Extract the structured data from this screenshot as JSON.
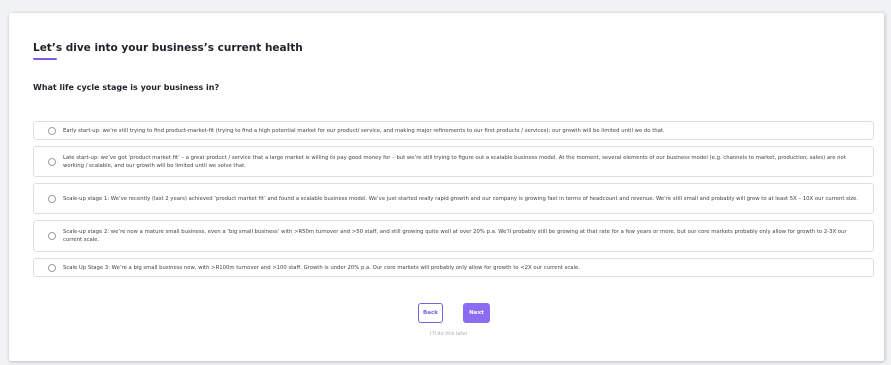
{
  "page": {
    "heading": "Let’s dive into your business’s current health",
    "question": "What life cycle stage is your business in?"
  },
  "options": [
    {
      "label": "Early start-up: we’re still trying to find product-market-fit (trying to find a high potential market for our product/ service, and making major refinements to our first products / services); our growth will be limited until we do that."
    },
    {
      "label": "Late start-up: we’ve got ‘product market fit’ – a great product / service that a large market is willing to pay good money for – but we’re still trying to figure out a scalable business model. At the moment, several elements of our business model (e.g. channels to market, production, sales) are not working / scalable, and our growth will be limited until we solve that."
    },
    {
      "label": "Scale-up stage 1: We’ve recently (last 2 years) achieved ‘product market fit’ and found a scalable business model. We’ve just started really rapid growth and our company is growing fast in terms of headcount and revenue. We’re still small and probably will grow to at least 5X – 10X our current size."
    },
    {
      "label": "Scale-up stage 2: we’re now a mature small business, even a ‘big small business’ with >R50m turnover and >50 staff, and still growing quite well at over 20% p.a. We’ll probably still be growing at that rate for a few years or more, but our core markets probably only allow for growth to 2-3X our current scale."
    },
    {
      "label": "Scale Up Stage 3: We’re a big small business now, with >R100m turnover and >100 staff. Growth is under 20% p.a. Our core markets will probably only allow for growth to <2X our current scale."
    }
  ],
  "actions": {
    "back_label": "Back",
    "next_label": "Next",
    "skip_label": "I’ll do this later"
  },
  "colors": {
    "accent": "#7b5ce6",
    "next_button": "#8b6cf0",
    "background": "#f1f2f4"
  }
}
